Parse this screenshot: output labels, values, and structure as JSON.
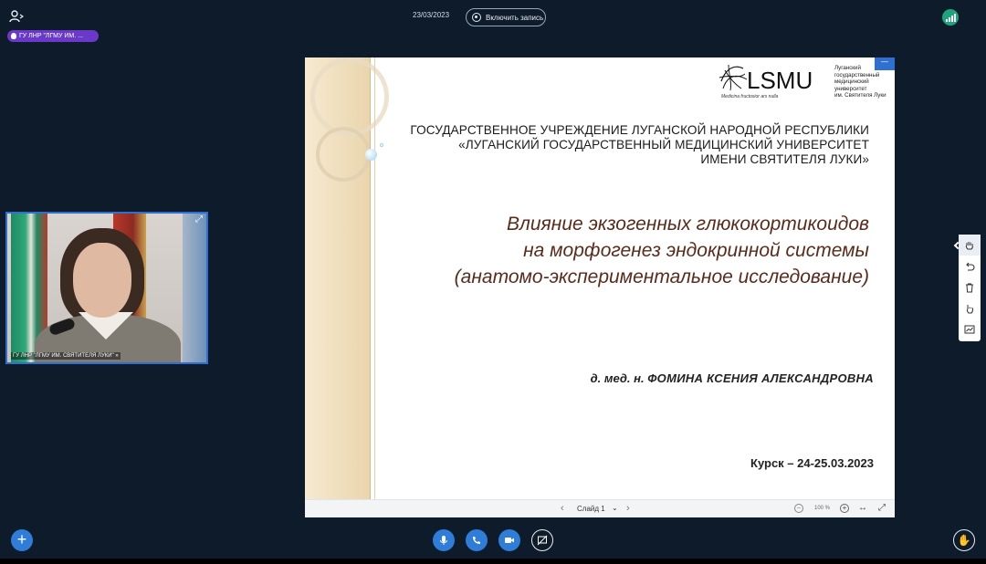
{
  "topbar": {
    "date": "23/03/2023",
    "record_label": "Включить запись"
  },
  "presenter": {
    "badge": "ГУ ЛНР \"ЛГМУ ИМ. ..."
  },
  "webcam": {
    "caption": "ГУ ЛНР \"ЛГМУ ИМ. СВЯТИТЕЛЯ ЛУКИ\" »"
  },
  "slide": {
    "logo_text": "LSMU",
    "logo_tagline": "Medicina fructosior ars nulla",
    "logo_side": [
      "Луганский",
      "государственный",
      "медицинский",
      "университет",
      "им. Святителя Луки"
    ],
    "corner_label": "—",
    "institution": [
      "ГОСУДАРСТВЕННОЕ УЧРЕЖДЕНИЕ ЛУГАНСКОЙ НАРОДНОЙ РЕСПУБЛИКИ",
      "«ЛУГАНСКИЙ ГОСУДАРСТВЕННЫЙ МЕДИЦИНСКИЙ УНИВЕРСИТЕТ",
      "ИМЕНИ СВЯТИТЕЛЯ ЛУКИ»"
    ],
    "topic": [
      "Влияние экзогенных глюкокортикоидов",
      "на морфогенез эндокринной системы",
      "(анатомо-экспериментальное исследование)"
    ],
    "author_degree": "д. мед. н.",
    "author_name": "ФОМИНА КСЕНИЯ АЛЕКСАНДРОВНА",
    "place_date": "Курск – 24-25.03.2023"
  },
  "slide_bar": {
    "slide_label": "Слайд 1",
    "zoom": "100 %"
  },
  "colors": {
    "background": "#0e1b2a",
    "accent": "#2f7dd8",
    "presenter_badge": "#6b39c9",
    "signal": "#1fa37a"
  }
}
